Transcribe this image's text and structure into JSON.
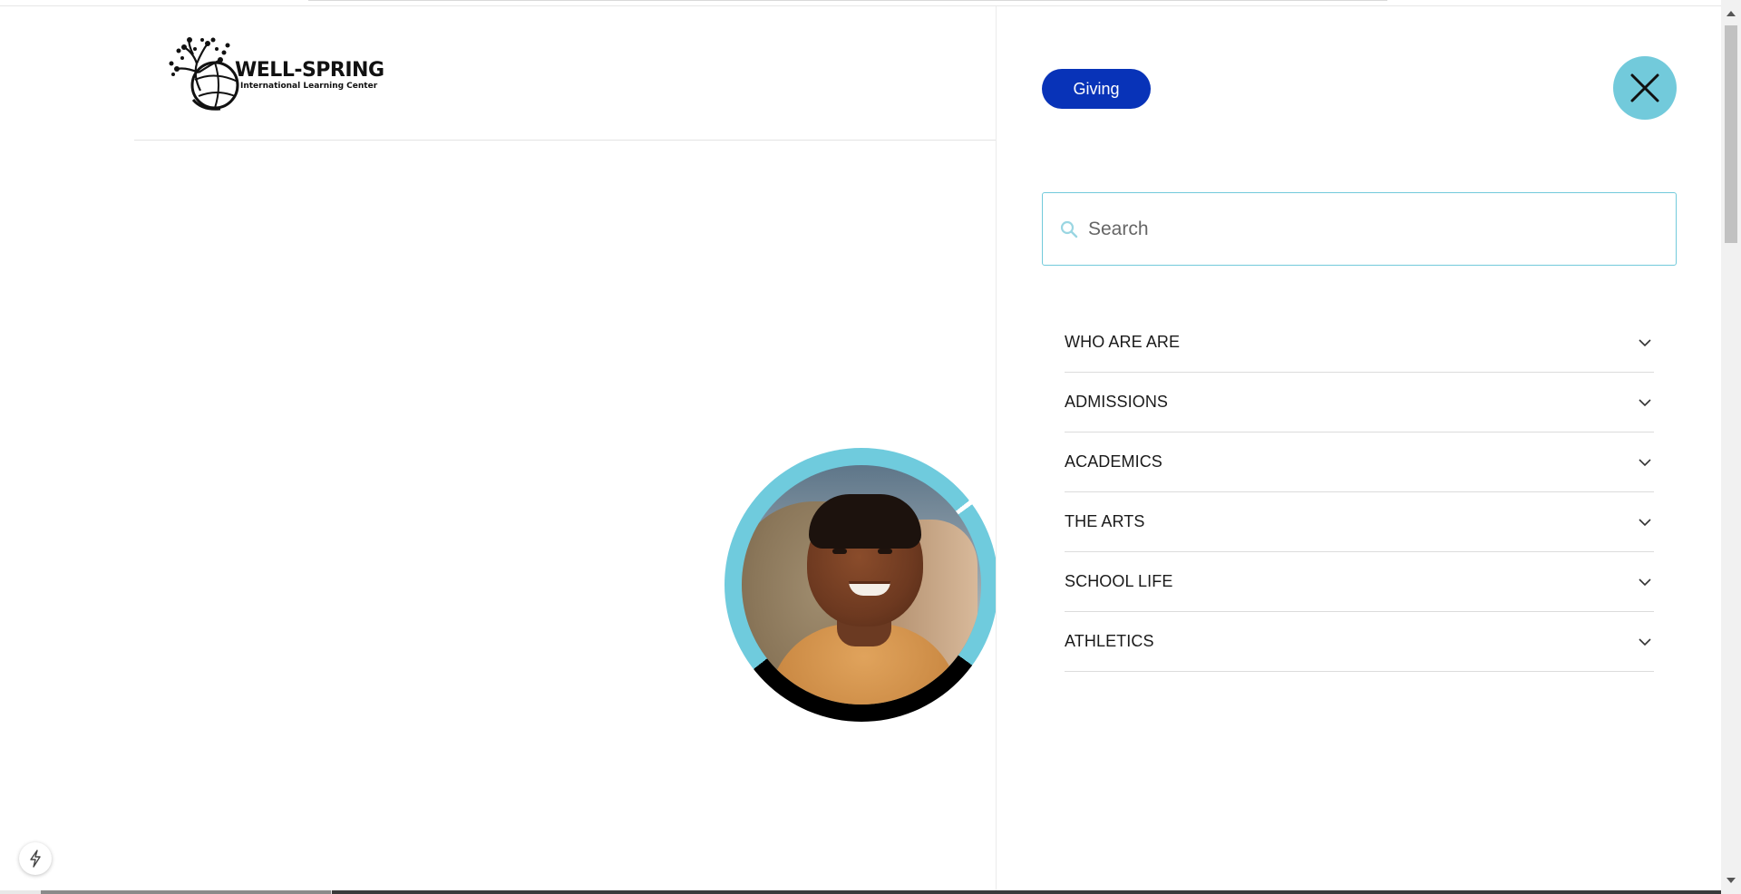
{
  "site": {
    "logo_name": "WELL-SPRING",
    "logo_subtitle": "International Learning Center"
  },
  "drawer": {
    "giving_label": "Giving",
    "search_placeholder": "Search",
    "nav_items": [
      {
        "label": "WHO ARE ARE"
      },
      {
        "label": "ADMISSIONS"
      },
      {
        "label": "ACADEMICS"
      },
      {
        "label": "THE ARTS"
      },
      {
        "label": "SCHOOL LIFE"
      },
      {
        "label": "ATHLETICS"
      }
    ]
  },
  "icons": {
    "close": "close-icon",
    "search": "search-icon",
    "chevron": "chevron-down-icon",
    "bolt": "bolt-icon",
    "logo_tree": "tree-globe-icon"
  },
  "colors": {
    "accent": "#72cadb",
    "giving_button": "#0833b8",
    "text": "#1a1a1a",
    "divider": "#dcdcdc"
  }
}
